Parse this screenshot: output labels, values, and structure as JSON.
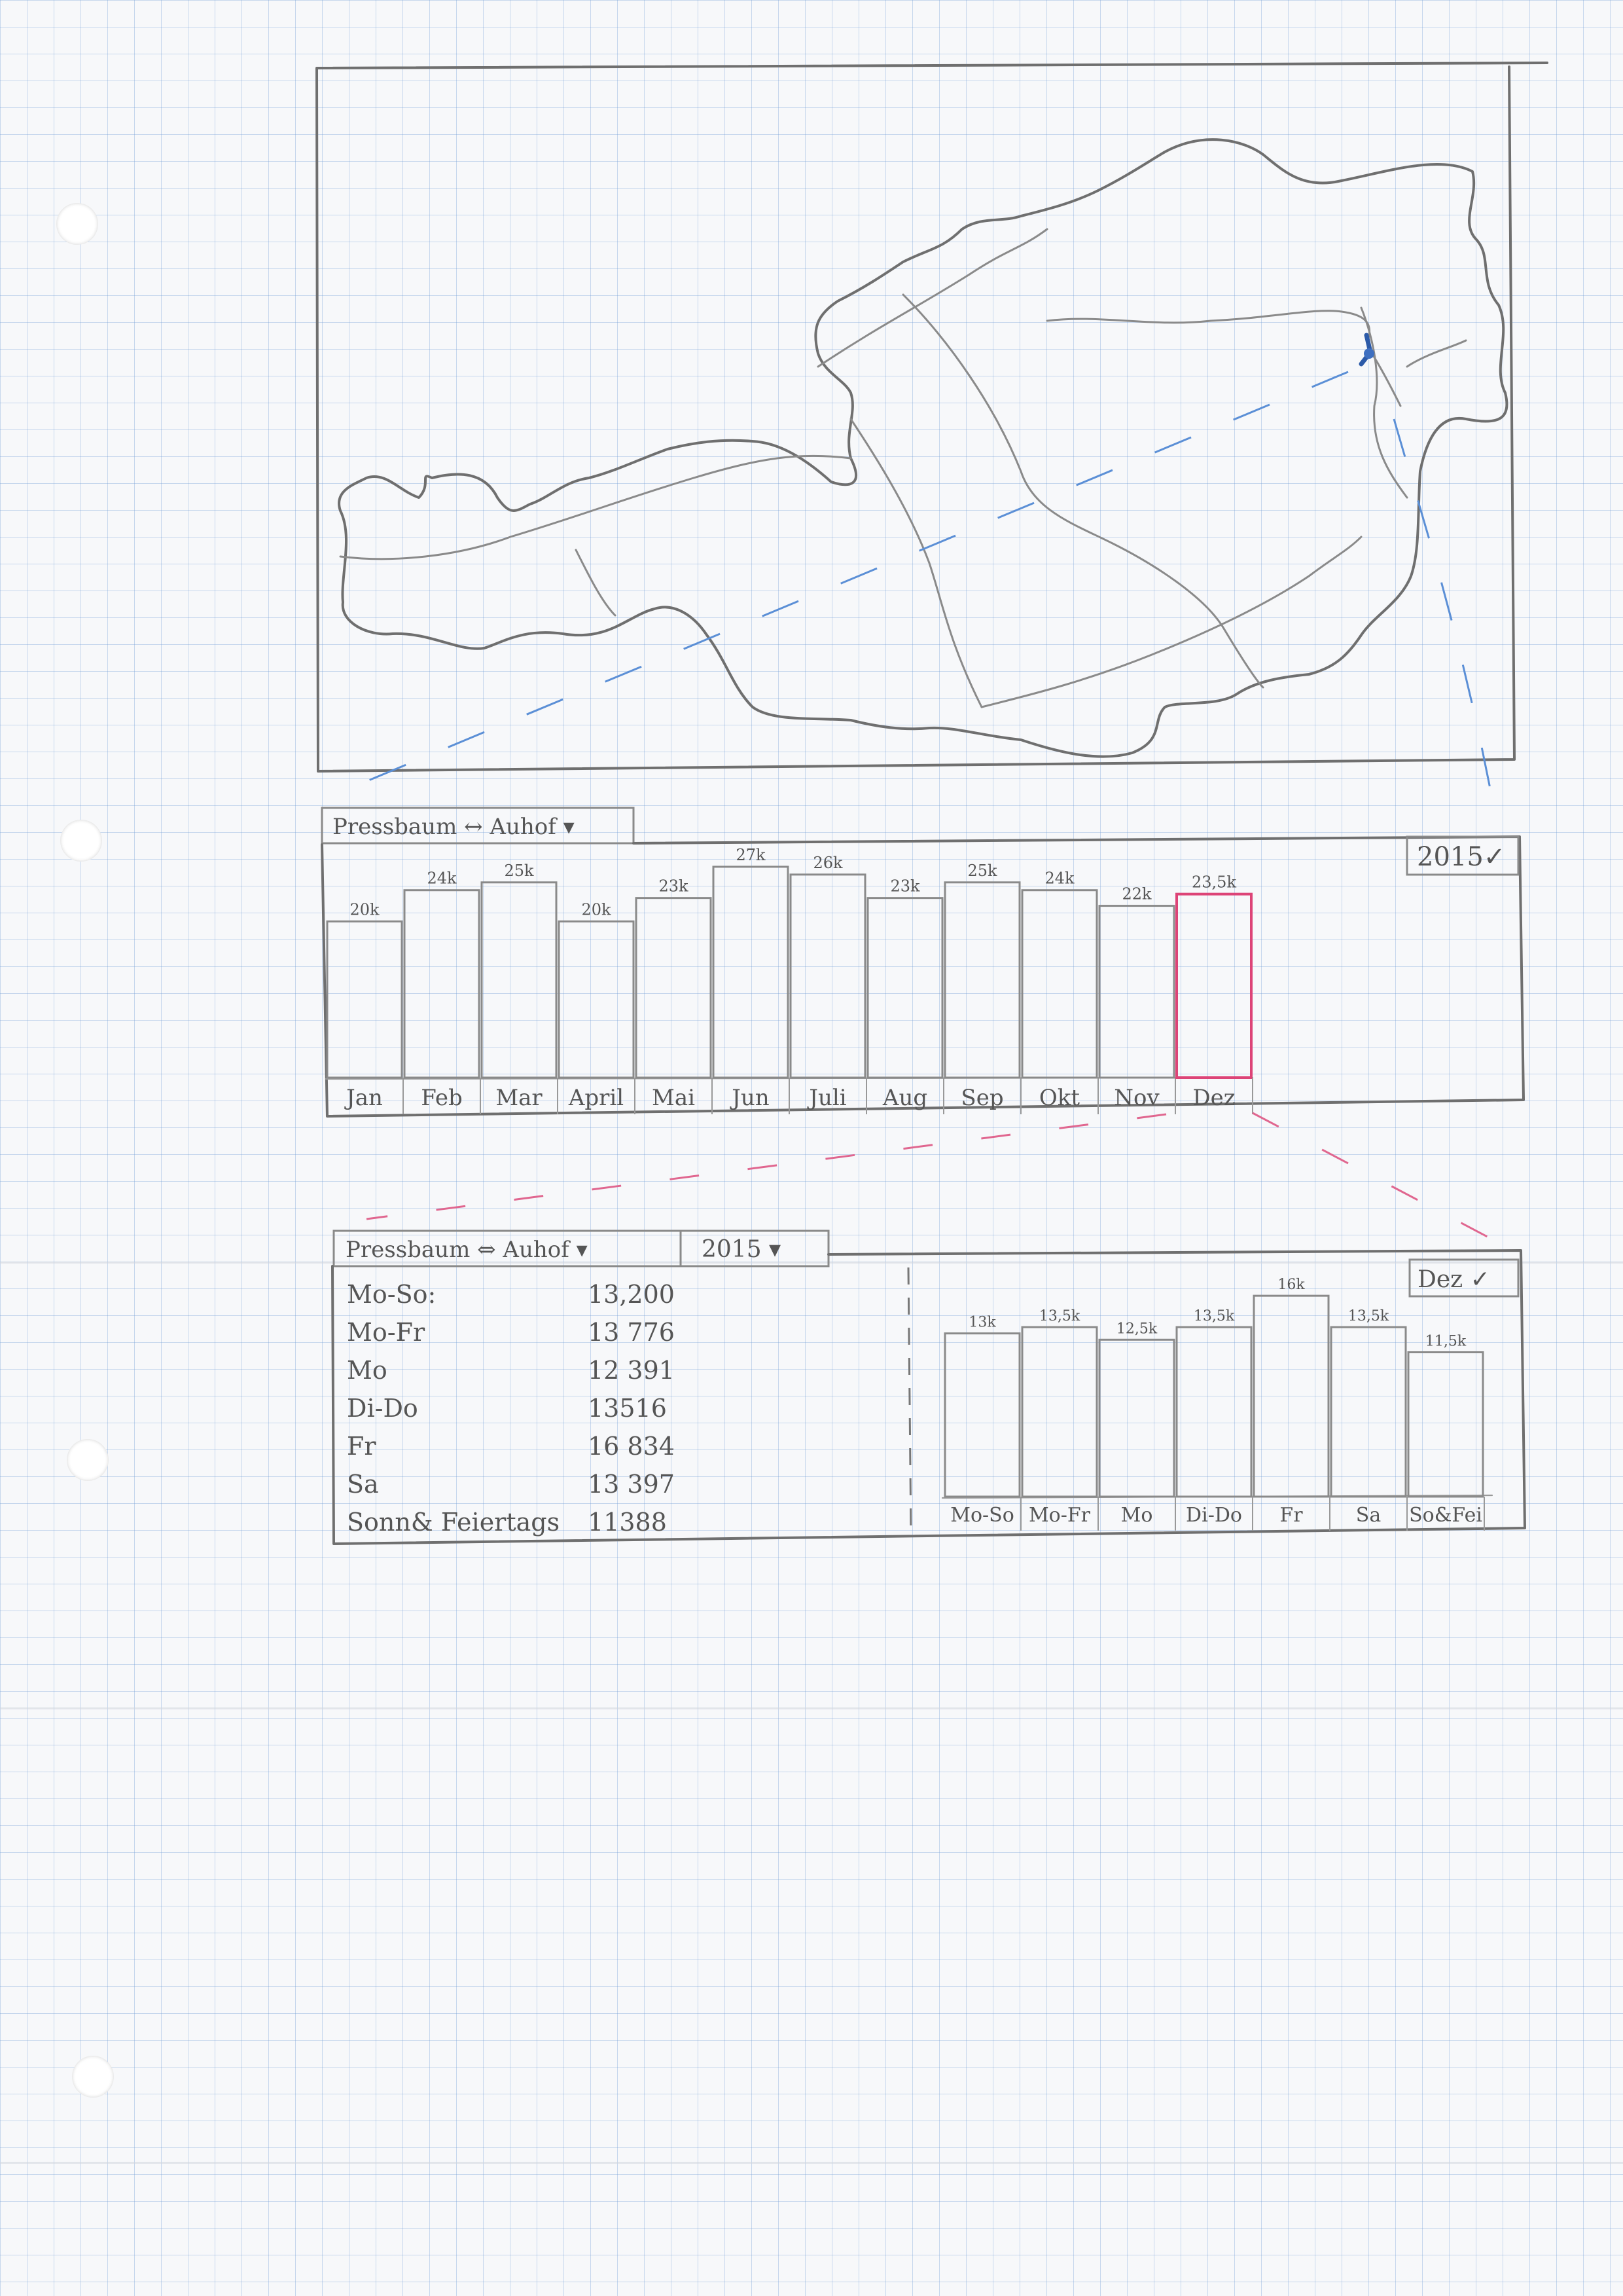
{
  "route_selector_1": {
    "label": "Pressbaum ↔ Auhof ▾"
  },
  "year_selector_1": {
    "label": "2015✓"
  },
  "monthly_chart": {
    "chart_data": {
      "type": "bar",
      "categories": [
        "Jan",
        "Feb",
        "Mar",
        "April",
        "Mai",
        "Jun",
        "Juli",
        "Aug",
        "Sep",
        "Okt",
        "Nov",
        "Dez"
      ],
      "values": [
        20,
        24,
        25,
        20,
        23,
        27,
        26,
        23,
        25,
        24,
        22,
        23.5
      ],
      "value_labels": [
        "20k",
        "24k",
        "25k",
        "20k",
        "23k",
        "27k",
        "26k",
        "23k",
        "25k",
        "24k",
        "22k",
        "23,5k"
      ],
      "ylim": [
        0,
        28
      ],
      "highlighted_category": "Dez"
    }
  },
  "route_selector_2": {
    "label": "Pressbaum ⇔ Auhof ▾"
  },
  "year_selector_2": {
    "label": "2015 ▾"
  },
  "month_selector": {
    "label": "Dez ✓"
  },
  "stats_table": {
    "rows": [
      {
        "label": "Mo-So:",
        "value": "13,200"
      },
      {
        "label": "Mo-Fr",
        "value": "13 776"
      },
      {
        "label": "Mo",
        "value": "12 391"
      },
      {
        "label": "Di-Do",
        "value": "13516"
      },
      {
        "label": "Fr",
        "value": "16 834"
      },
      {
        "label": "Sa",
        "value": "13 397"
      },
      {
        "label": "Sonn& Feiertags",
        "value": "11388"
      }
    ]
  },
  "weekday_chart": {
    "chart_data": {
      "type": "bar",
      "categories": [
        "Mo-So",
        "Mo-Fr",
        "Mo",
        "Di-Do",
        "Fr",
        "Sa",
        "So&Fei"
      ],
      "values": [
        13,
        13.5,
        12.5,
        13.5,
        16,
        13.5,
        11.5
      ],
      "value_labels": [
        "13k",
        "13,5k",
        "12,5k",
        "13,5k",
        "16k",
        "13,5k",
        "11,5k"
      ],
      "ylim": [
        0,
        17
      ]
    }
  }
}
